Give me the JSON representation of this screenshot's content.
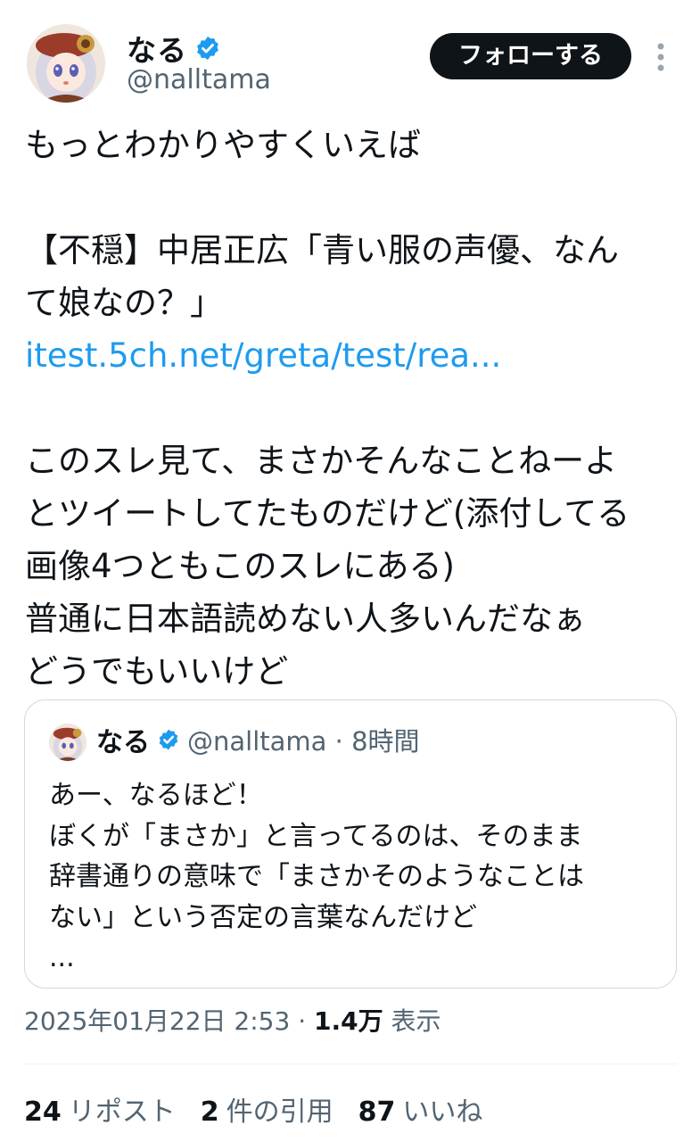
{
  "author": {
    "display_name": "なる",
    "handle": "@nalltama"
  },
  "follow_label": "フォローする",
  "tweet": {
    "lines": [
      "もっとわかりやすくいえば",
      "",
      "【不穏】中居正広「青い服の声優、なん",
      "て娘なの？」",
      "itest.5ch.net/greta/test/rea...",
      "",
      "このスレ見て、まさかそんなことねーよ",
      "とツイートしてたものだけど(添付してる",
      "画像4つともこのスレにある)",
      "普通に日本語読めない人多いんだなぁ",
      "どうでもいいけど"
    ]
  },
  "quote": {
    "display_name": "なる",
    "handle_time": "@nalltama · 8時間",
    "lines": [
      "あー、なるほど！",
      "ぼくが「まさか」と言ってるのは、そのまま",
      "辞書通りの意味で「まさかそのようなことは",
      "ない」という否定の言葉なんだけど",
      "..."
    ]
  },
  "meta": {
    "timestamp": "2025年01月22日 2:53 · ",
    "views_count": "1.4万",
    "views_label": " 表示"
  },
  "stats": {
    "reposts_count": "24",
    "reposts_label": "リポスト",
    "quotes_count": "2",
    "quotes_label": "件の引用",
    "likes_count": "87",
    "likes_label": "いいね"
  },
  "colors": {
    "link": "#1d9bf0",
    "verified": "#1d9bf0",
    "secondary_text": "#536471",
    "follow_button": "#0f1419"
  }
}
